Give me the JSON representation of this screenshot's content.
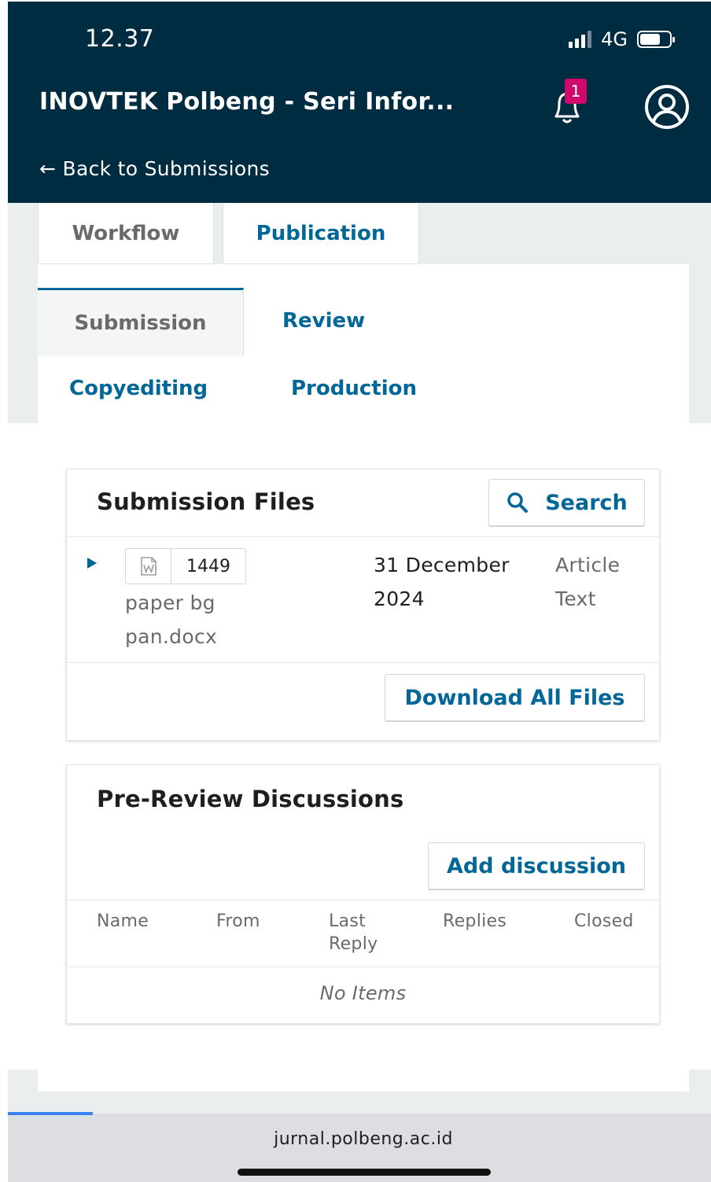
{
  "status_bar": {
    "time": "12.37",
    "network": "4G",
    "battery_percent": 70
  },
  "header": {
    "title": "INOVTEK Polbeng - Seri Infor...",
    "notification_count": "1",
    "back_link": "← Back to Submissions"
  },
  "tabs": {
    "workflow": "Workflow",
    "publication": "Publication",
    "active": "Workflow"
  },
  "workflow_tabs": {
    "submission": "Submission",
    "review": "Review",
    "copyediting": "Copyediting",
    "production": "Production",
    "active": "Submission"
  },
  "submission_files": {
    "title": "Submission Files",
    "search_label": "Search",
    "files": [
      {
        "id": "1449",
        "name": "paper bg pan.docx",
        "date": "31 December 2024",
        "type": "Article Text"
      }
    ],
    "download_label": "Download All Files"
  },
  "discussions": {
    "title": "Pre-Review Discussions",
    "add_label": "Add discussion",
    "columns": [
      "Name",
      "From",
      "Last Reply",
      "Replies",
      "Closed"
    ],
    "empty_text": "No Items"
  },
  "browser": {
    "url": "jurnal.polbeng.ac.id"
  },
  "colors": {
    "header_bg": "#002c41",
    "accent": "#006798",
    "badge": "#d00a6c"
  }
}
